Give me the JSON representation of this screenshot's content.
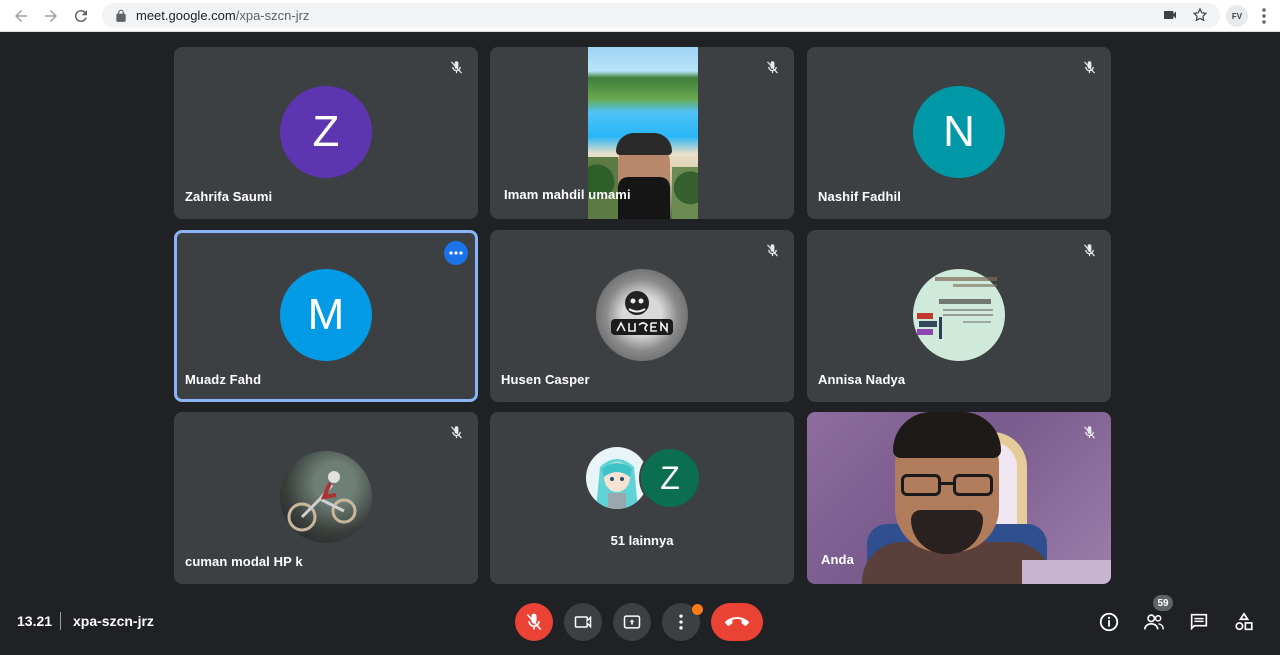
{
  "browser": {
    "url_host": "meet.google.com",
    "url_path": "/xpa-szcn-jrz",
    "profile_initials": "FV"
  },
  "tiles": [
    {
      "name": "Zahrifa Saumi",
      "initial": "Z",
      "color": "#5e35b1",
      "muted": true
    },
    {
      "name": "Imam mahdil umami",
      "muted": true
    },
    {
      "name": "Nashif Fadhil",
      "initial": "N",
      "color": "#0097a7",
      "muted": true
    },
    {
      "name": "Muadz Fahd",
      "initial": "M",
      "color": "#039be5",
      "muted": false,
      "active": true
    },
    {
      "name": "Husen Casper",
      "muted": true
    },
    {
      "name": "Annisa Nadya",
      "muted": true
    },
    {
      "name": "cuman modal HP k",
      "muted": true
    },
    {
      "others_label": "51 lainnya",
      "initial": "Z",
      "color": "#0b6e4f"
    },
    {
      "name": "Anda",
      "muted": true
    }
  ],
  "bottom": {
    "time": "13.21",
    "meeting_code": "xpa-szcn-jrz",
    "participants_count": "59"
  },
  "colors": {
    "background": "#202124",
    "tile": "#3c4043",
    "active_border": "#8ab4f8",
    "danger": "#ea4335",
    "notify": "#fa7b17"
  }
}
